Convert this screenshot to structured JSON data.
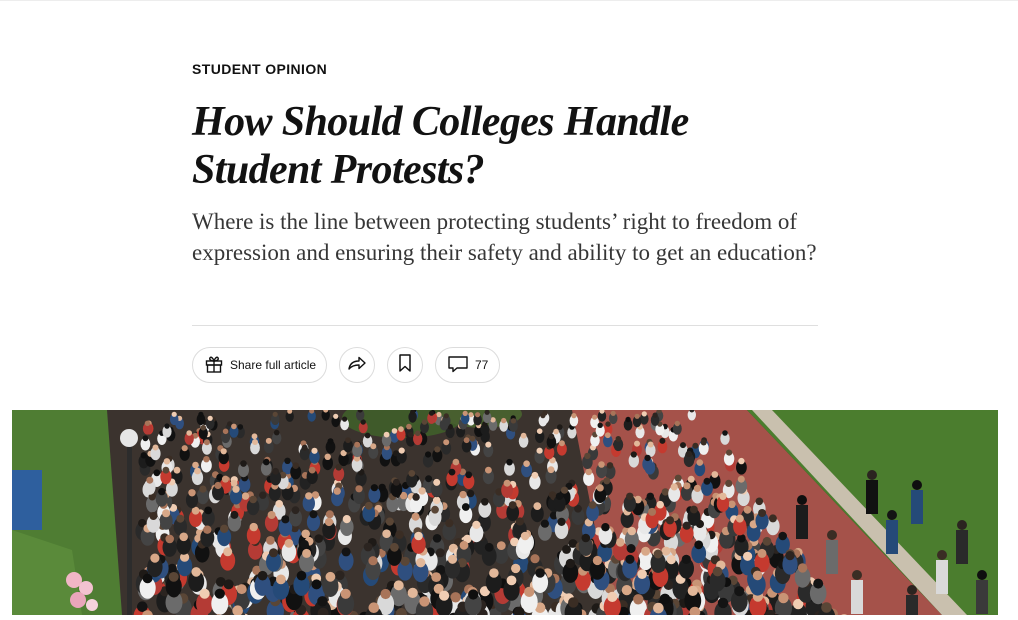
{
  "article": {
    "kicker": "STUDENT OPINION",
    "headline": "How Should Colleges Handle Student Protests?",
    "summary": "Where is the line between protecting students’ right to freedom of expression and ensuring their safety and ability to get an education?"
  },
  "toolbar": {
    "share_label": "Share full article",
    "comment_count": "77",
    "icons": {
      "share": "gift-icon",
      "forward": "forward-arrow-icon",
      "save": "bookmark-icon",
      "comments": "comment-bubble-icon"
    }
  },
  "lead_image": {
    "subject": "crowd-photo"
  },
  "colors": {
    "text": "#121212",
    "summary_text": "#363636",
    "border": "#dcdcdc",
    "divider": "#dfdfdf"
  }
}
